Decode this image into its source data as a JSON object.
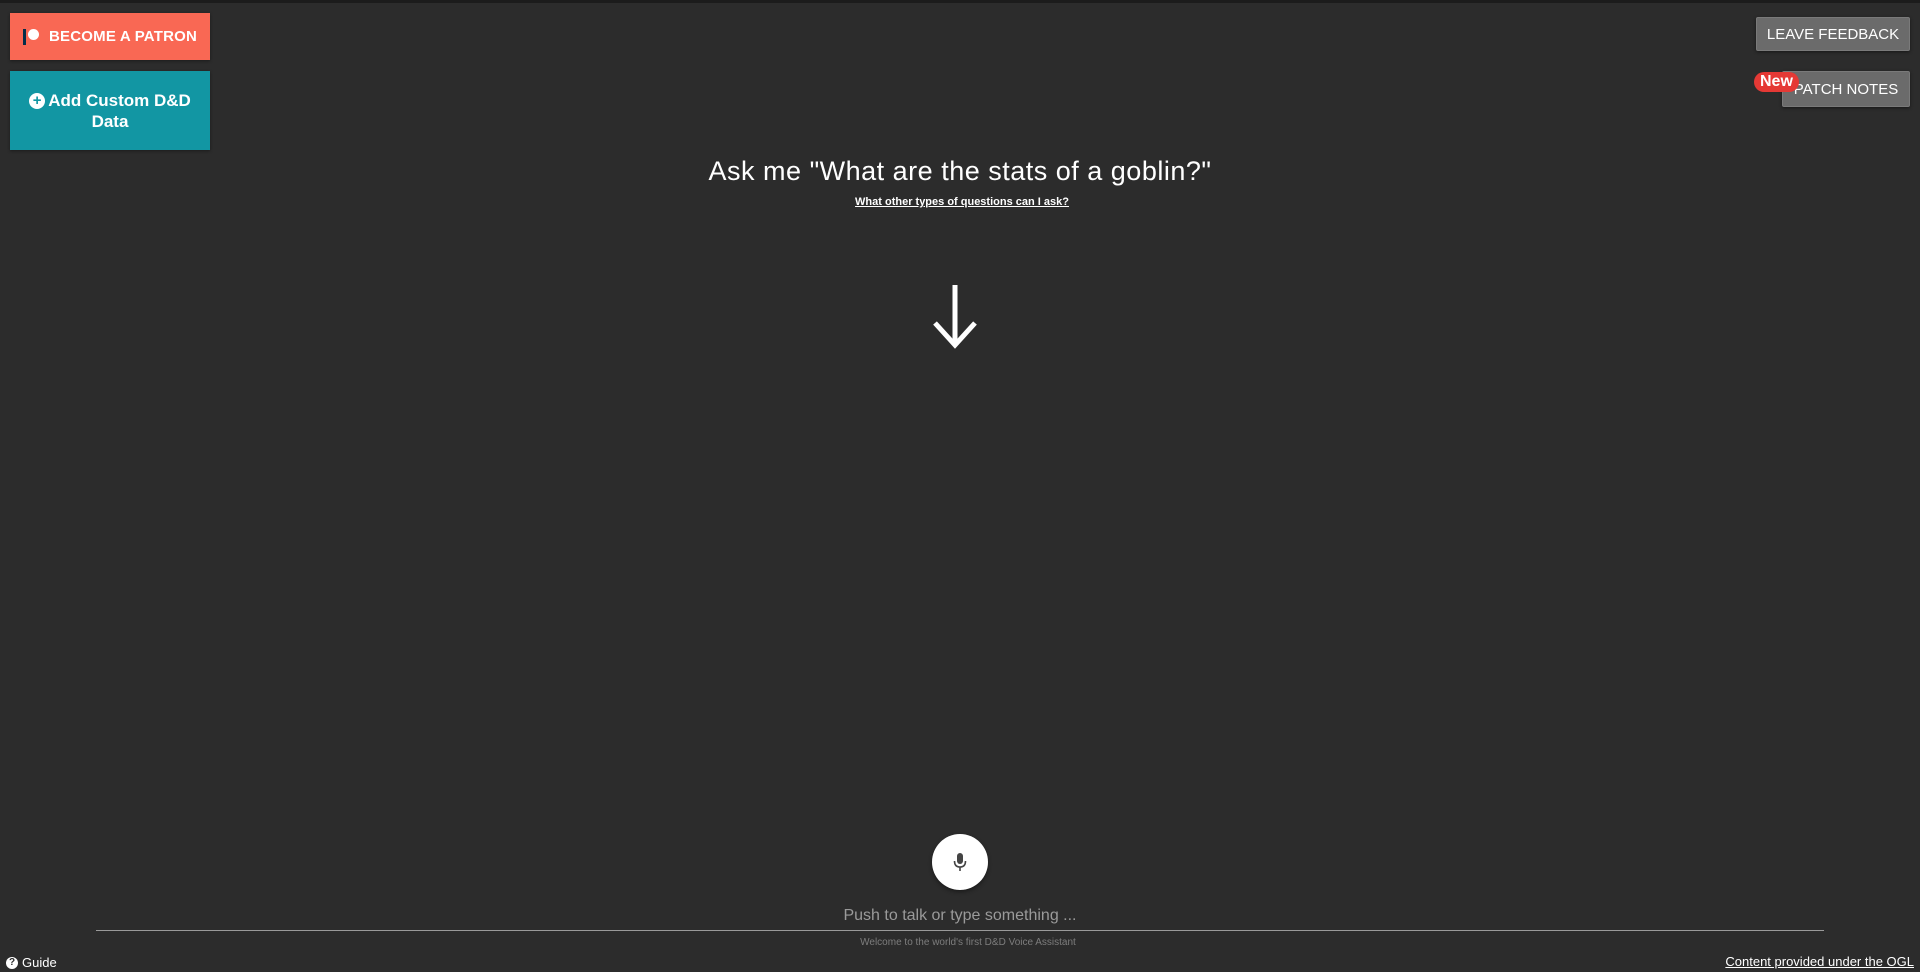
{
  "header": {
    "patron_button_label": "BECOME A PATRON",
    "custom_data_button_label": "Add Custom D&D Data",
    "feedback_button_label": "LEAVE FEEDBACK",
    "patch_notes_button_label": "PATCH NOTES",
    "new_badge_label": "New"
  },
  "main": {
    "prompt_title": "Ask me \"What are the stats of a goblin?\"",
    "help_link_label": "What other types of questions can I ask?"
  },
  "input": {
    "placeholder": "Push to talk or type something ...",
    "value": "",
    "welcome_text": "Welcome to the world's first D&D Voice Assistant"
  },
  "footer": {
    "guide_label": "Guide",
    "ogl_link_label": "Content provided under the OGL"
  },
  "icons": {
    "patron": "patreon-icon",
    "plus": "plus-circle-icon",
    "arrow": "arrow-down-icon",
    "mic": "microphone-icon",
    "help": "question-circle-icon"
  },
  "colors": {
    "background": "#2c2c2c",
    "patron": "#f96854",
    "custom_data": "#1296a3",
    "badge": "#e53935",
    "secondary_button": "#6b6b6b"
  }
}
